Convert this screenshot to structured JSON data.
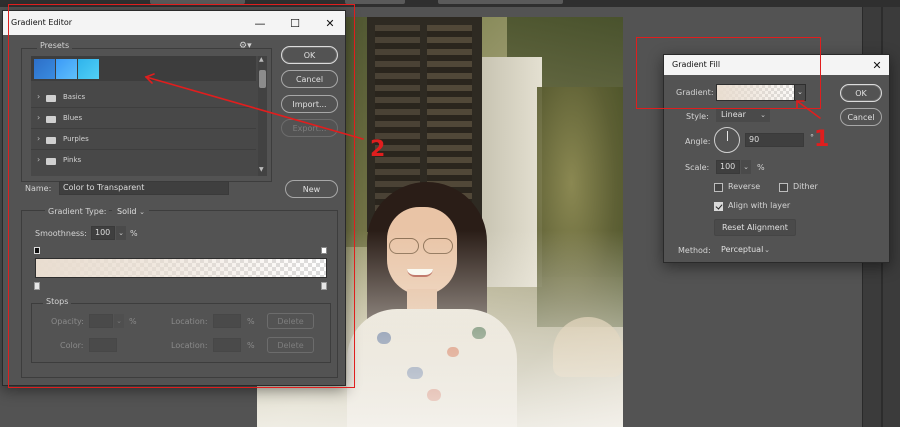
{
  "gradient_editor": {
    "title": "Gradient Editor",
    "presets": {
      "label": "Presets",
      "swatches": [
        "#3a7fd1",
        "#4aa6f5",
        "#35c0f0"
      ],
      "folders": [
        "Basics",
        "Blues",
        "Purples",
        "Pinks"
      ]
    },
    "buttons": {
      "ok": "OK",
      "cancel": "Cancel",
      "import": "Import...",
      "export": "Export...",
      "new": "New"
    },
    "name_label": "Name:",
    "name_value": "Color to Transparent",
    "gradient_type_label": "Gradient Type:",
    "gradient_type_value": "Solid",
    "smoothness_label": "Smoothness:",
    "smoothness_value": "100",
    "smoothness_unit": "%",
    "stops": {
      "label": "Stops",
      "opacity_label": "Opacity:",
      "location_label": "Location:",
      "color_label": "Color:",
      "pct": "%",
      "delete_label": "Delete"
    },
    "gradient_color": "#e9ddd0"
  },
  "gradient_fill": {
    "title": "Gradient Fill",
    "gradient_label": "Gradient:",
    "style_label": "Style:",
    "style_value": "Linear",
    "angle_label": "Angle:",
    "angle_value": "90",
    "angle_unit": "°",
    "scale_label": "Scale:",
    "scale_value": "100",
    "scale_unit": "%",
    "reverse_label": "Reverse",
    "dither_label": "Dither",
    "align_label": "Align with layer",
    "reset_label": "Reset Alignment",
    "method_label": "Method:",
    "method_value": "Perceptual",
    "buttons": {
      "ok": "OK",
      "cancel": "Cancel"
    },
    "checks": {
      "reverse": false,
      "dither": false,
      "align": true
    }
  },
  "annotations": {
    "marker_1": "1",
    "marker_2": "2",
    "color": "#e01e1e"
  },
  "colors": {
    "dialog_bg": "#535353",
    "title_bar": "#f4f4f4",
    "workspace": "#535353",
    "annotation_red": "#e01e1e"
  }
}
